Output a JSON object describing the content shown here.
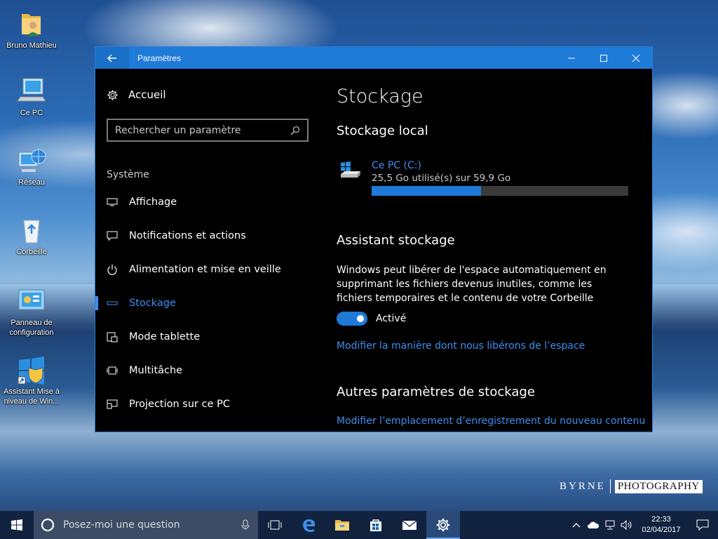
{
  "desktop": {
    "icons": [
      {
        "label": "Bruno Mathieu"
      },
      {
        "label": "Ce PC"
      },
      {
        "label": "Réseau"
      },
      {
        "label": "Corbeille"
      },
      {
        "label": "Panneau de configuration"
      },
      {
        "label": "Assistant Mise à niveau de Win..."
      }
    ]
  },
  "window": {
    "title": "Paramètres",
    "sidebar": {
      "home_label": "Accueil",
      "search_placeholder": "Rechercher un paramètre",
      "section_label": "Système",
      "items": [
        {
          "label": "Affichage",
          "icon": "monitor-icon"
        },
        {
          "label": "Notifications et actions",
          "icon": "speech-bubble-icon"
        },
        {
          "label": "Alimentation et mise en veille",
          "icon": "power-icon"
        },
        {
          "label": "Stockage",
          "icon": "storage-icon",
          "active": true
        },
        {
          "label": "Mode tablette",
          "icon": "tablet-mode-icon"
        },
        {
          "label": "Multitâche",
          "icon": "multitask-icon"
        },
        {
          "label": "Projection sur ce PC",
          "icon": "projection-icon"
        }
      ]
    },
    "content": {
      "title": "Stockage",
      "local_storage_heading": "Stockage local",
      "drive": {
        "name": "Ce PC (C:)",
        "usage": "25,5 Go utilisé(s) sur 59,9 Go",
        "used_fraction": 0.426
      },
      "storage_sense_heading": "Assistant stockage",
      "storage_sense_desc": "Windows peut libérer de l'espace automatiquement en supprimant les fichiers devenus inutiles, comme les fichiers temporaires et le contenu de votre Corbeille",
      "toggle_label": "Activé",
      "toggle_on": true,
      "change_link": "Modifier la manière dont nous libérons de l’espace",
      "other_heading": "Autres paramètres de stockage",
      "save_location_link": "Modifier l’emplacement d’enregistrement du nouveau contenu"
    }
  },
  "watermark": {
    "left": "BYRNE",
    "right": "PHOTOGRAPHY"
  },
  "taskbar": {
    "search_placeholder": "Posez-moi une question",
    "pinned": [
      "task-view-icon",
      "edge-icon",
      "file-explorer-icon",
      "store-icon",
      "mail-icon",
      "settings-icon"
    ],
    "clock_time": "22:33",
    "clock_date": "02/04/2017"
  },
  "colors": {
    "accent": "#1f7bd8",
    "link": "#3b8ff0"
  }
}
